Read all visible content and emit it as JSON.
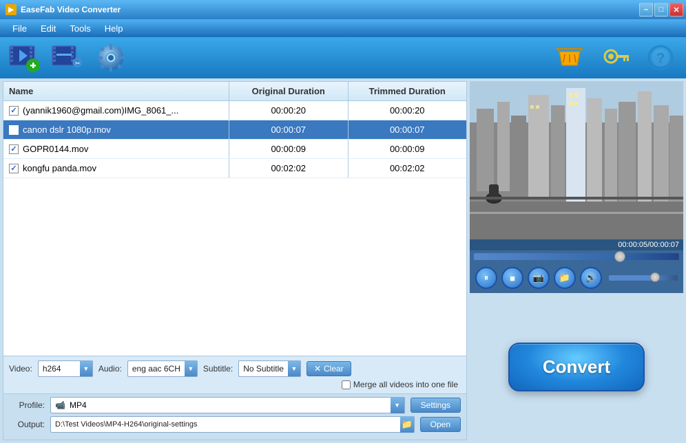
{
  "window": {
    "title": "EaseFab Video Converter",
    "controls": {
      "minimize": "–",
      "maximize": "□",
      "close": "✕"
    }
  },
  "menu": {
    "items": [
      "File",
      "Edit",
      "Tools",
      "Help"
    ]
  },
  "toolbar": {
    "add_video_tooltip": "Add Video",
    "edit_video_tooltip": "Edit Video",
    "settings_tooltip": "Settings"
  },
  "file_table": {
    "headers": {
      "name": "Name",
      "original_duration": "Original Duration",
      "trimmed_duration": "Trimmed Duration"
    },
    "rows": [
      {
        "checked": true,
        "selected": false,
        "name": "(yannik1960@gmail.com)IMG_8061_...",
        "original_duration": "00:00:20",
        "trimmed_duration": "00:00:20"
      },
      {
        "checked": true,
        "selected": true,
        "name": "canon dslr 1080p.mov",
        "original_duration": "00:00:07",
        "trimmed_duration": "00:00:07"
      },
      {
        "checked": true,
        "selected": false,
        "name": "GOPR0144.mov",
        "original_duration": "00:00:09",
        "trimmed_duration": "00:00:09"
      },
      {
        "checked": true,
        "selected": false,
        "name": "kongfu panda.mov",
        "original_duration": "00:02:02",
        "trimmed_duration": "00:02:02"
      }
    ]
  },
  "bottom_controls": {
    "video_label": "Video:",
    "video_value": "h264",
    "audio_label": "Audio:",
    "audio_value": "eng aac 6CH",
    "subtitle_label": "Subtitle:",
    "subtitle_value": "No Subtitle",
    "clear_label": "Clear",
    "merge_label": "Merge all videos into one file"
  },
  "profile_area": {
    "profile_label": "Profile:",
    "profile_value": "MP4",
    "profile_icon": "📹",
    "settings_label": "Settings",
    "output_label": "Output:",
    "output_value": "D:\\Test Videos\\MP4-H264\\original-settings",
    "open_label": "Open"
  },
  "preview": {
    "time_display": "00:00:05/00:00:07"
  },
  "convert": {
    "label": "Convert"
  }
}
